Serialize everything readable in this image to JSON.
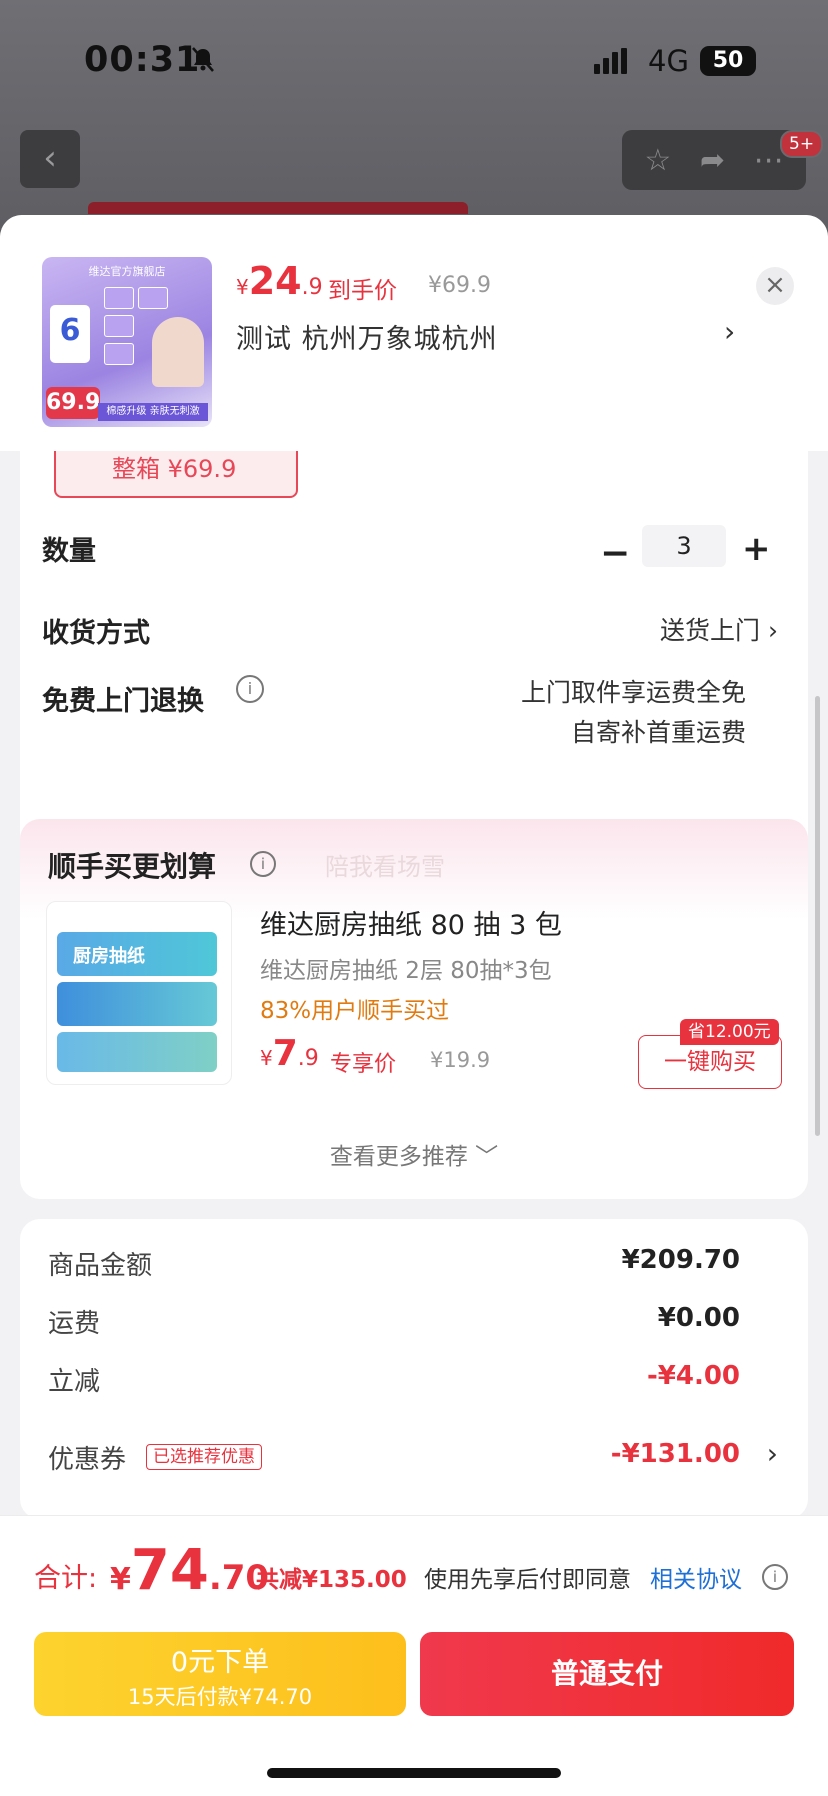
{
  "status": {
    "time": "00:31",
    "network": "4G",
    "battery": "50"
  },
  "nav": {
    "back": "‹",
    "badge": "5+"
  },
  "header": {
    "price_yen": "¥",
    "price_int": "24",
    "price_dec": ".9",
    "price_label": "到手价",
    "original_price": "¥69.9",
    "address": "测试  杭州万象城杭州",
    "thumb_shop": "维达官方旗舰店",
    "thumb_count": "6",
    "thumb_price": "69.9",
    "thumb_band": "棉感升级 亲肤无刺激"
  },
  "spec_chip": {
    "label": "整箱 ¥69.9"
  },
  "quantity": {
    "label": "数量",
    "minus": "−",
    "value": "3",
    "plus": "+"
  },
  "delivery": {
    "label": "收货方式",
    "value": "送货上门"
  },
  "returns": {
    "label": "免费上门退换",
    "line1": "上门取件享运费全免",
    "line2": "自寄补首重运费"
  },
  "recommend": {
    "title": "顺手买更划算",
    "watermark": "陪我看场雪",
    "product": {
      "name": "维达厨房抽纸 80 抽 3 包",
      "sub": "维达厨房抽纸 2层 80抽*3包",
      "rate": "83%用户顺手买过",
      "price_yen": "¥",
      "price_int": "7",
      "price_dec": ".9",
      "price_label": "专享价",
      "orig_price": "¥19.9",
      "save_tag": "省12.00元",
      "buy_label": "一键购买",
      "img_label": "厨房抽纸"
    },
    "more": "查看更多推荐 ﹀"
  },
  "fees": [
    {
      "label": "商品金额",
      "value": "¥209.70"
    },
    {
      "label": "运费",
      "value": "¥0.00"
    },
    {
      "label": "立减",
      "value": "-¥4.00"
    },
    {
      "label": "优惠券",
      "value": "-¥131.00",
      "tag": "已选推荐优惠"
    }
  ],
  "bottom": {
    "total_label": "合计:",
    "total_yen": "¥",
    "total_int": "74",
    "total_dec": ".70",
    "total_reduced": "共减¥135.00",
    "agree_text": "使用先享后付即同意",
    "agree_link": "相关协议",
    "pay_later_line1": "0元下单",
    "pay_later_line2": "15天后付款¥74.70",
    "pay_normal": "普通支付"
  },
  "colors": {
    "accent_red": "#e8323e",
    "pay_later_yellow": "#fdc81f",
    "link_blue": "#1e6fd6"
  }
}
